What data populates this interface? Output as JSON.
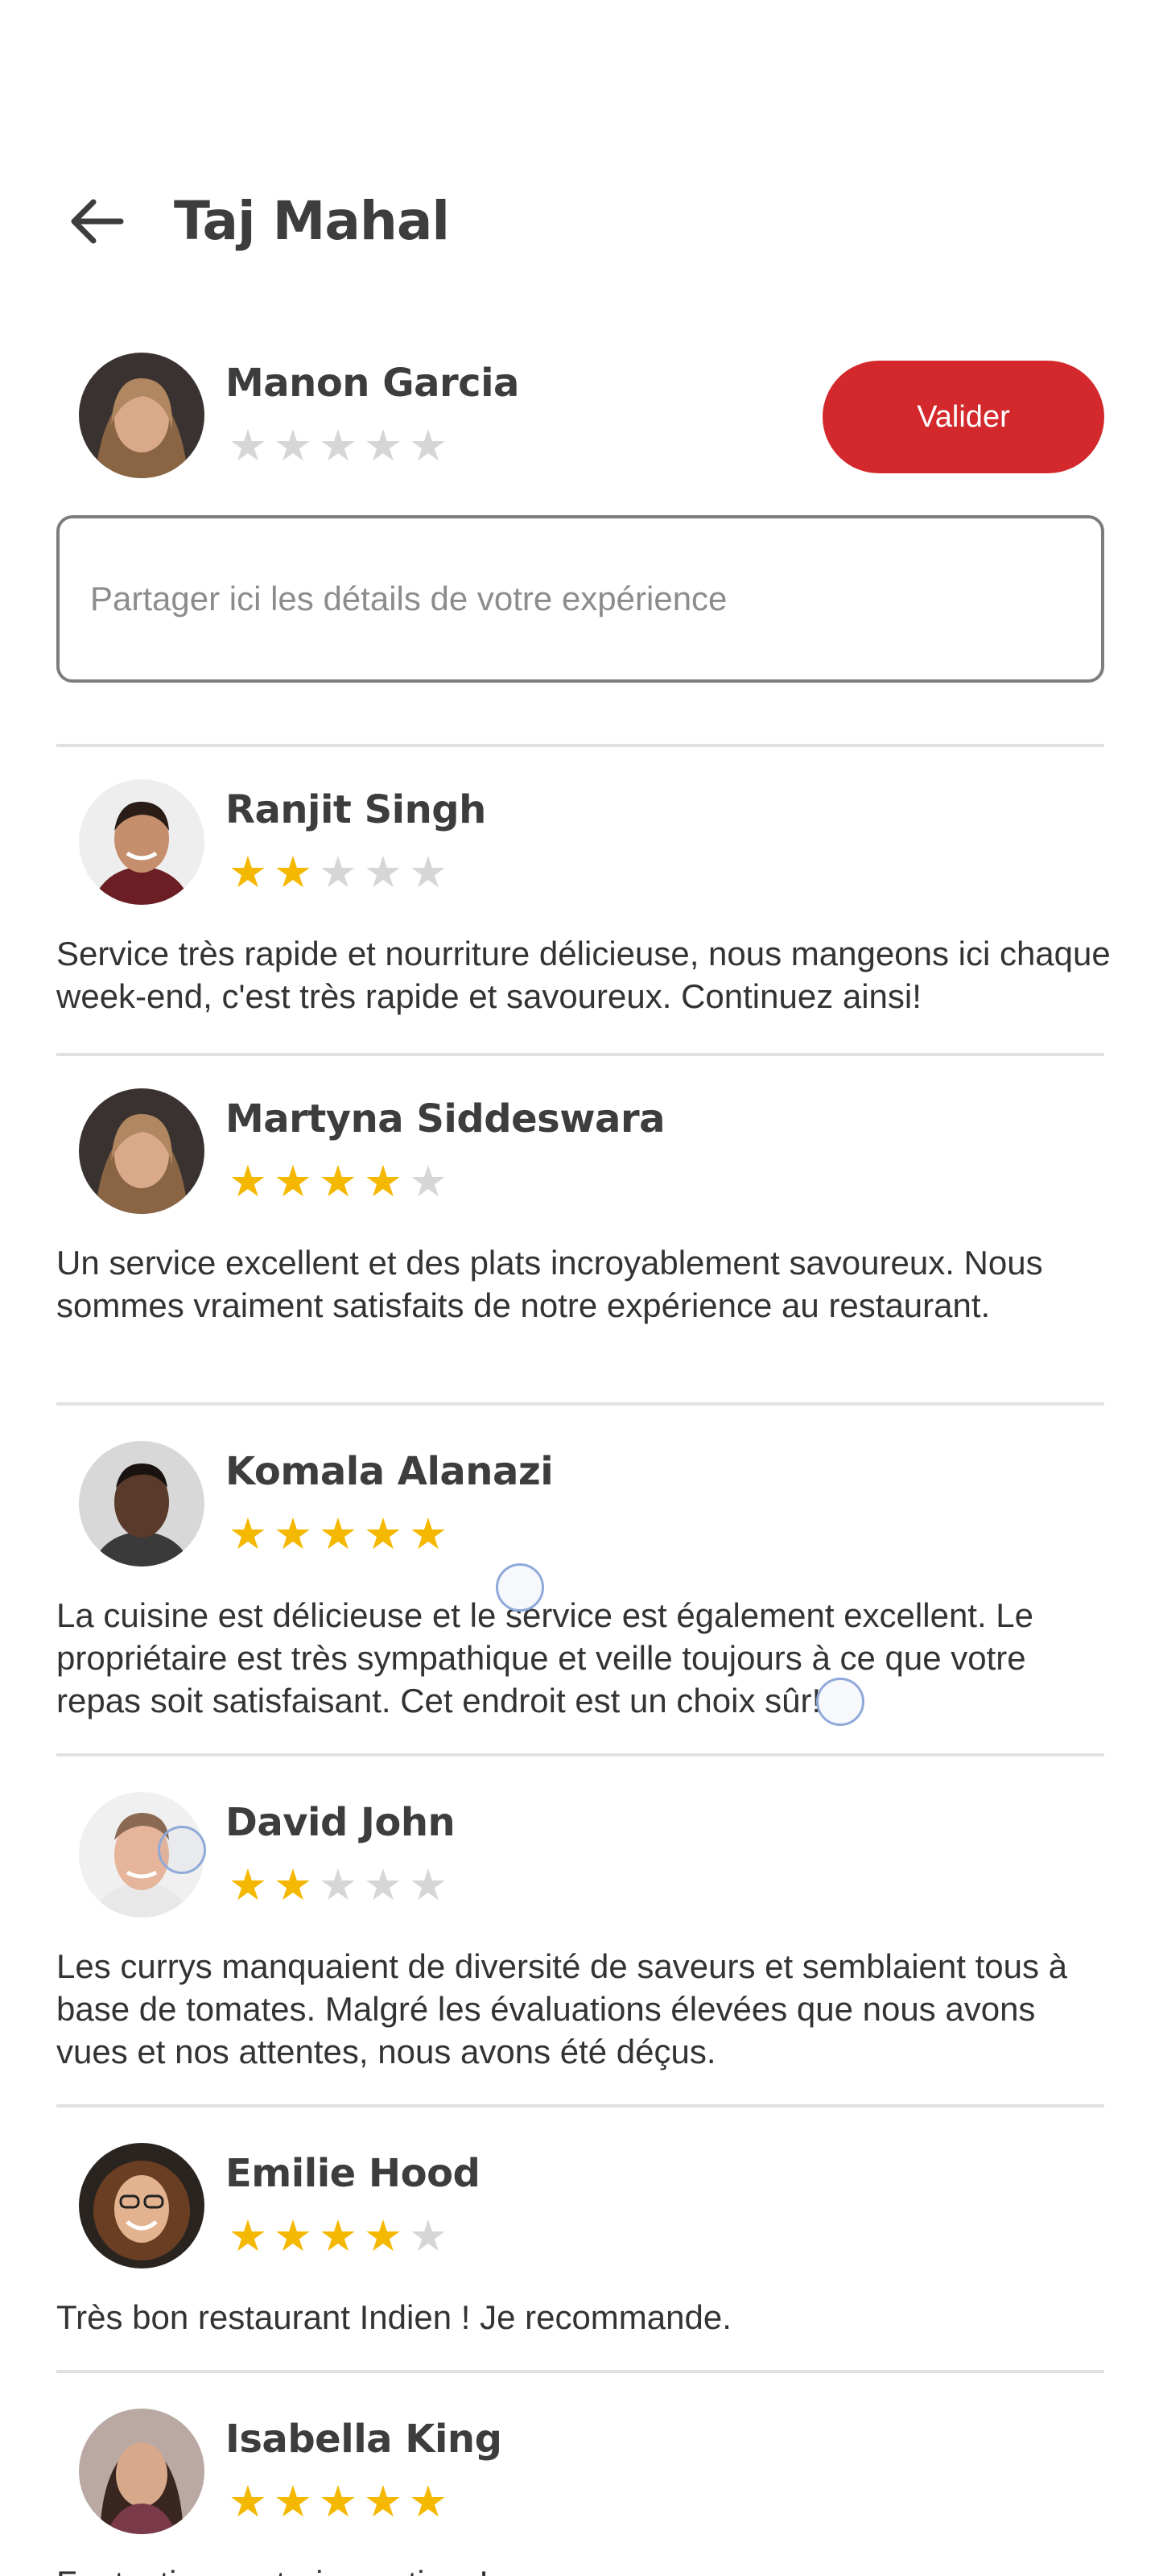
{
  "header": {
    "title": "Taj Mahal"
  },
  "composer": {
    "user_name": "Manon Garcia",
    "rating": 0,
    "submit_label": "Valider",
    "input_placeholder": "Partager ici les détails de votre expérience",
    "input_value": ""
  },
  "reviews": [
    {
      "name": "Ranjit Singh",
      "rating": 2,
      "text": "Service très rapide et nourriture délicieuse, nous mangeons ici chaque week-end, c'est très rapide et savoureux. Continuez ainsi!"
    },
    {
      "name": "Martyna Siddeswara",
      "rating": 4,
      "text": "Un service excellent et des plats incroyablement savoureux. Nous sommes vraiment satisfaits de notre expérience au restaurant."
    },
    {
      "name": "Komala Alanazi",
      "rating": 5,
      "text": "La cuisine est délicieuse et le service est également excellent. Le propriétaire est très sympathique et veille toujours à ce que votre repas soit satisfaisant. Cet endroit est un choix sûr!"
    },
    {
      "name": "David John",
      "rating": 2,
      "text": "Les currys manquaient de diversité de saveurs et semblaient tous à base de tomates. Malgré les évaluations élevées que nous avons vues et nos attentes, nous avons été déçus."
    },
    {
      "name": "Emilie Hood",
      "rating": 4,
      "text": "Très bon restaurant Indien ! Je recommande."
    },
    {
      "name": "Isabella King",
      "rating": 5,
      "text": "Fantastic vegetarian options!"
    }
  ],
  "colors": {
    "accent": "#d3292c",
    "star_on": "#f5b800",
    "star_off": "#d6d6d6"
  },
  "icons": {
    "back": "arrow-left-icon",
    "star": "star-icon"
  }
}
